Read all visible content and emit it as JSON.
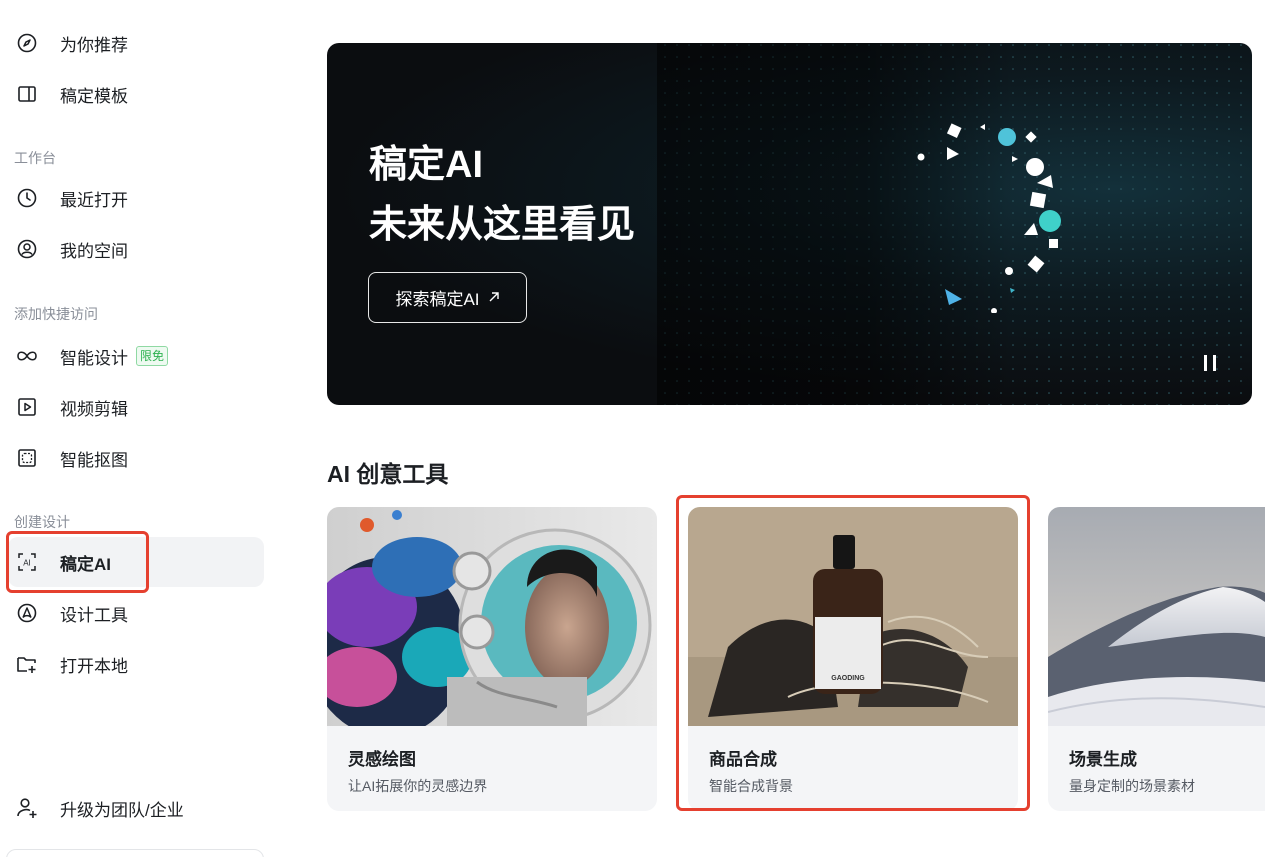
{
  "sidebar": {
    "top_items": [
      {
        "label": "为你推荐",
        "icon": "compass-icon"
      },
      {
        "label": "稿定模板",
        "icon": "template-icon"
      }
    ],
    "workspace": {
      "title": "工作台",
      "items": [
        {
          "label": "最近打开",
          "icon": "clock-icon"
        },
        {
          "label": "我的空间",
          "icon": "user-space-icon"
        }
      ]
    },
    "quick_access": {
      "title": "添加快捷访问",
      "items": [
        {
          "label": "智能设计",
          "icon": "infinity-icon",
          "badge": "限免"
        },
        {
          "label": "视频剪辑",
          "icon": "video-play-icon"
        },
        {
          "label": "智能抠图",
          "icon": "cutout-icon"
        }
      ]
    },
    "create": {
      "title": "创建设计",
      "items": [
        {
          "label": "稿定AI",
          "icon": "ai-icon",
          "active": true
        },
        {
          "label": "设计工具",
          "icon": "design-tool-icon"
        },
        {
          "label": "打开本地",
          "icon": "folder-add-icon"
        }
      ]
    },
    "upgrade": {
      "label": "升级为团队/企业",
      "icon": "add-user-icon"
    }
  },
  "banner": {
    "title_line1": "稿定AI",
    "title_line2": "未来从这里看见",
    "button_label": "探索稿定AI",
    "button_icon": "arrow-up-right-icon",
    "pause_icon": "pause-icon"
  },
  "section": {
    "heading": "AI 创意工具",
    "cards": [
      {
        "title": "灵感绘图",
        "subtitle": "让AI拓展你的灵感边界",
        "image": "astronaut-art-image"
      },
      {
        "title": "商品合成",
        "subtitle": "智能合成背景",
        "image": "product-bottle-image",
        "bottle_label": "GAODING"
      },
      {
        "title": "场景生成",
        "subtitle": "量身定制的场景素材",
        "image": "snow-mountain-image"
      }
    ]
  },
  "colors": {
    "highlight": "#e5402f",
    "badge_green": "#2db14f",
    "banner_bg": "#0b0d10"
  }
}
